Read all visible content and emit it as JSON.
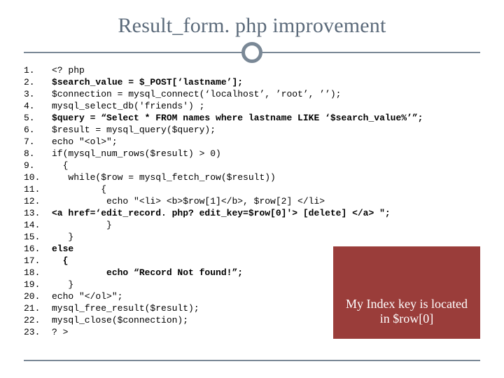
{
  "title": "Result_form. php improvement",
  "code": {
    "lines": [
      {
        "n": "1.",
        "bold": false,
        "text": "<? php"
      },
      {
        "n": "2.",
        "bold": true,
        "text": "$search_value = $_POST[‘lastname’];"
      },
      {
        "n": "3.",
        "bold": false,
        "text": "$connection = mysql_connect(‘localhost’, ’root’, ’’);"
      },
      {
        "n": "4.",
        "bold": false,
        "text": "mysql_select_db('friends') ;"
      },
      {
        "n": "5.",
        "bold": true,
        "text": "$query = “Select * FROM names where lastname LIKE ‘$search_value%’”;"
      },
      {
        "n": "6.",
        "bold": false,
        "text": "$result = mysql_query($query);"
      },
      {
        "n": "7.",
        "bold": false,
        "text": "echo \"<ol>\";"
      },
      {
        "n": "8.",
        "bold": false,
        "text": "if(mysql_num_rows($result) > 0)"
      },
      {
        "n": "9.",
        "bold": false,
        "text": "  {"
      },
      {
        "n": "10.",
        "bold": false,
        "text": "   while($row = mysql_fetch_row($result))"
      },
      {
        "n": "11.",
        "bold": false,
        "text": "         {"
      },
      {
        "n": "12.",
        "bold": false,
        "text": "          echo \"<li> <b>$row[1]</b>, $row[2] </li>"
      },
      {
        "n": "13.",
        "bold": true,
        "text": "<a href=‘edit_record. php? edit_key=$row[0]'> [delete] </a> \";"
      },
      {
        "n": "14.",
        "bold": false,
        "text": "          }"
      },
      {
        "n": "15.",
        "bold": false,
        "text": "   }"
      },
      {
        "n": "16.",
        "bold": true,
        "text": "else"
      },
      {
        "n": "17.",
        "bold": true,
        "text": "  {"
      },
      {
        "n": "18.",
        "bold": true,
        "text": "          echo “Record Not found!”;"
      },
      {
        "n": "",
        "bold": false,
        "text": ""
      },
      {
        "n": "19.",
        "bold": false,
        "text": "   }"
      },
      {
        "n": "20.",
        "bold": false,
        "text": "echo \"</ol>\";"
      },
      {
        "n": "21.",
        "bold": false,
        "text": "mysql_free_result($result);"
      },
      {
        "n": "22.",
        "bold": false,
        "text": "mysql_close($connection);"
      },
      {
        "n": "23.",
        "bold": false,
        "text": "? >"
      }
    ]
  },
  "callout": "My Index key is located in $row[0]"
}
